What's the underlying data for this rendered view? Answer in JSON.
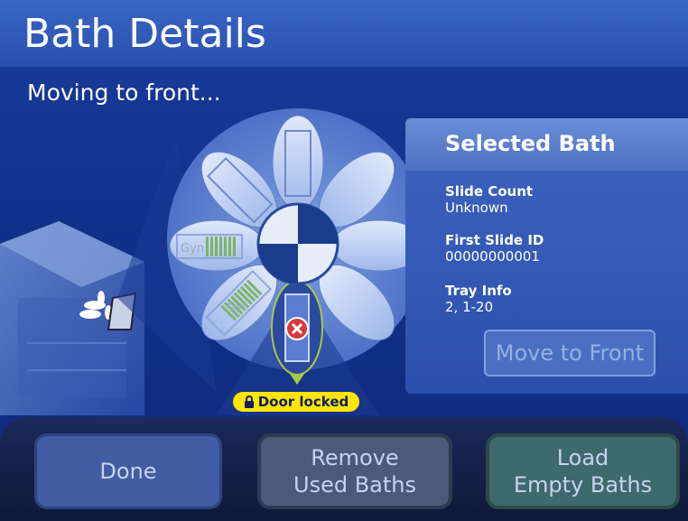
{
  "header": {
    "title": "Bath Details"
  },
  "status": {
    "text": "Moving to front..."
  },
  "selected_bath": {
    "title": "Selected Bath",
    "slide_count_label": "Slide Count",
    "slide_count_value": "Unknown",
    "first_slide_label": "First Slide ID",
    "first_slide_value": "00000000001",
    "tray_info_label": "Tray Info",
    "tray_info_value": "2, 1-20",
    "move_button_label": "Move to Front"
  },
  "carousel": {
    "door_status": "Door locked",
    "bath_tags": [
      "Gyn",
      "Gyn"
    ],
    "selected_mark": "error-icon"
  },
  "actions": {
    "done_label": "Done",
    "remove_label_line1": "Remove",
    "remove_label_line2": "Used Baths",
    "load_label_line1": "Load",
    "load_label_line2": "Empty Baths"
  },
  "colors": {
    "accent": "#2950ae",
    "lock_badge": "#ffe500",
    "error": "#d33c3c"
  }
}
